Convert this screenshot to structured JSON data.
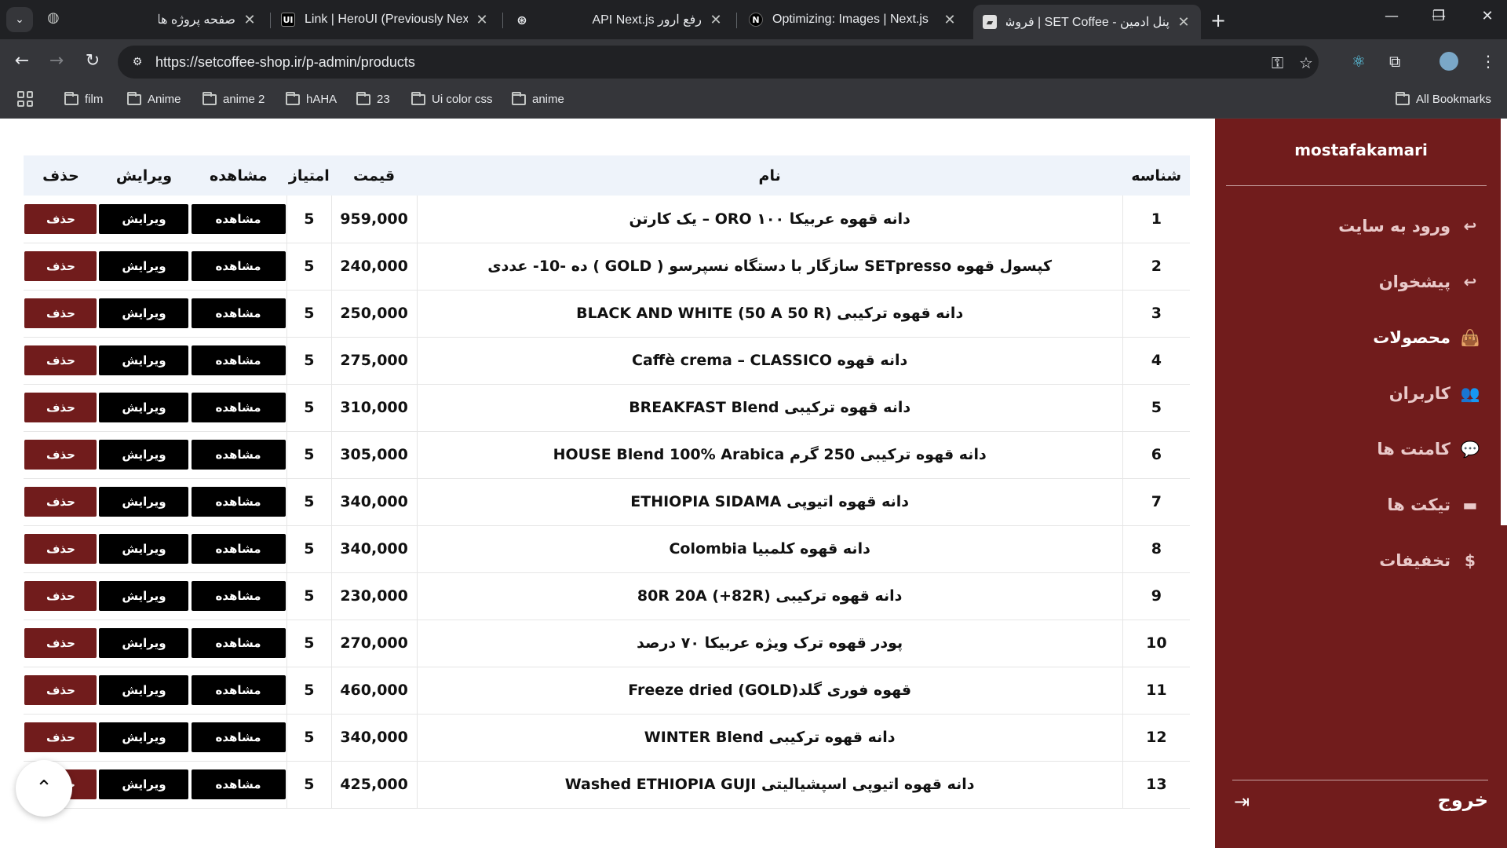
{
  "browser": {
    "tabs": [
      {
        "title": "صفحه پروژه ها",
        "favicon": "globe-icon",
        "active": false
      },
      {
        "title": "Link | HeroUI (Previously NextUI)",
        "favicon": "heroui-icon",
        "active": false
      },
      {
        "title": "رفع ارور API Next.js",
        "favicon": "openai-icon",
        "active": false
      },
      {
        "title": "Optimizing: Images | Next.js",
        "favicon": "nextjs-icon",
        "active": false
      },
      {
        "title": "پنل ادمین - SET Coffee | فروشگاه",
        "favicon": "setcoffee-icon",
        "active": true
      }
    ],
    "url": "https://setcoffee-shop.ir/p-admin/products",
    "bookmarks": [
      "film",
      "Anime",
      "anime 2",
      "hAHA",
      "23",
      "Ui color css",
      "anime"
    ],
    "all_bookmarks_label": "All Bookmarks"
  },
  "sidebar": {
    "username": "mostafakamari",
    "items": [
      {
        "label": "ورود به سایت",
        "icon": "reply-arrow-icon",
        "active": false
      },
      {
        "label": "پیشخوان",
        "icon": "reply-arrow-icon",
        "active": false
      },
      {
        "label": "محصولات",
        "icon": "shopping-bag-icon",
        "active": true
      },
      {
        "label": "کاربران",
        "icon": "users-icon",
        "active": false
      },
      {
        "label": "کامنت ها",
        "icon": "comments-icon",
        "active": false
      },
      {
        "label": "تیکت ها",
        "icon": "ticket-message-icon",
        "active": false
      },
      {
        "label": "تخفیفات",
        "icon": "dollar-icon",
        "active": false
      }
    ],
    "logout_label": "خروج"
  },
  "table": {
    "headers": {
      "id": "شناسه",
      "name": "نام",
      "price": "قیمت",
      "score": "امتیاز",
      "view": "مشاهده",
      "edit": "ویرایش",
      "delete": "حذف"
    },
    "button_labels": {
      "view": "مشاهده",
      "edit": "ویرایش",
      "delete": "حذف"
    },
    "rows": [
      {
        "id": "1",
        "name": "دانه قهوه عربیکا ۱۰۰ ORO – یک کارتن",
        "price": "959,000",
        "score": "5"
      },
      {
        "id": "2",
        "name": "کپسول قهوه SETpresso سازگار با دستگاه نسپرسو ( GOLD ) ده -10- عددی",
        "price": "240,000",
        "score": "5"
      },
      {
        "id": "3",
        "name": "دانه قهوه ترکیبی BLACK AND WHITE (50 A 50 R)",
        "price": "250,000",
        "score": "5"
      },
      {
        "id": "4",
        "name": "دانه قهوه Caffè crema – CLASSICO",
        "price": "275,000",
        "score": "5"
      },
      {
        "id": "5",
        "name": "دانه قهوه ترکیبی BREAKFAST Blend",
        "price": "310,000",
        "score": "5"
      },
      {
        "id": "6",
        "name": "دانه قهوه ترکیبی 250 گرم HOUSE Blend 100% Arabica",
        "price": "305,000",
        "score": "5"
      },
      {
        "id": "7",
        "name": "دانه قهوه اتیوپی ETHIOPIA SIDAMA",
        "price": "340,000",
        "score": "5"
      },
      {
        "id": "8",
        "name": "دانه قهوه کلمبیا Colombia",
        "price": "340,000",
        "score": "5"
      },
      {
        "id": "9",
        "name": "دانه قهوه ترکیبی (82R+) 80R 20A",
        "price": "230,000",
        "score": "5"
      },
      {
        "id": "10",
        "name": "پودر قهوه ترک ویژه عربیکا ۷۰ درصد",
        "price": "270,000",
        "score": "5"
      },
      {
        "id": "11",
        "name": "قهوه فوری گلد(GOLD) Freeze dried",
        "price": "460,000",
        "score": "5"
      },
      {
        "id": "12",
        "name": "دانه قهوه ترکیبی WINTER Blend",
        "price": "340,000",
        "score": "5"
      },
      {
        "id": "13",
        "name": "دانه قهوه اتیوپی اسپشیالیتی Washed ETHIOPIA GUJI",
        "price": "425,000",
        "score": "5"
      }
    ]
  },
  "colors": {
    "sidebar_bg": "#711c1c",
    "delete_button": "#711c1c",
    "view_edit_button": "#000000",
    "table_header_bg": "#eef3fa"
  }
}
